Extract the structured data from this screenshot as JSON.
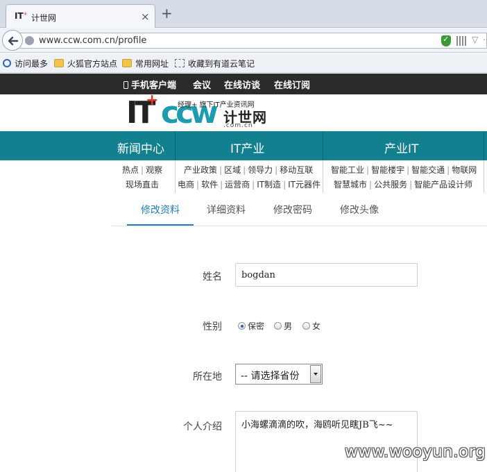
{
  "browser": {
    "tab_favicon_text": "IT",
    "tab_title": "计世网",
    "close_glyph": "×",
    "new_tab_glyph": "+",
    "url": "www.ccw.com.cn/profile",
    "bookmarks": [
      "访问最多",
      "火狐官方站点",
      "常用网址",
      "收藏到有道云笔记"
    ]
  },
  "topbar": {
    "items": [
      "手机客户端",
      "会议",
      "在线访谈",
      "在线订阅"
    ]
  },
  "logo": {
    "it": "IT",
    "ccw": "ccw",
    "plus": "+",
    "cn_name": "计世网",
    "domain": ".com.cn",
    "tagline": "经理+ 旗下IT产业资讯网"
  },
  "main_nav": [
    "新闻中心",
    "IT产业",
    "产业IT"
  ],
  "sub_nav": {
    "news": [
      [
        "热点",
        "观察"
      ],
      [
        "现场直击"
      ]
    ],
    "it_industry": [
      [
        "产业政策",
        "区域",
        "领导力",
        "移动互联"
      ],
      [
        "电商",
        "软件",
        "运营商",
        "IT制造",
        "IT元器件"
      ]
    ],
    "industry_it": [
      [
        "智能工业",
        "智能楼宇",
        "智能交通",
        "物联网"
      ],
      [
        "智慧城市",
        "公共服务",
        "智能产品设计师"
      ]
    ]
  },
  "profile_tabs": [
    "修改资料",
    "详细资料",
    "修改密码",
    "修改头像"
  ],
  "form": {
    "name_label": "姓名",
    "name_value": "bogdan",
    "gender_label": "性别",
    "gender_options": [
      "保密",
      "男",
      "女"
    ],
    "gender_selected": "保密",
    "location_label": "所在地",
    "location_value": "-- 请选择省份",
    "bio_label": "个人介绍",
    "bio_value": "小海螺滴滴的吹，海鸥听见瞎JB飞~~"
  },
  "watermark": "www.wooyun.org"
}
